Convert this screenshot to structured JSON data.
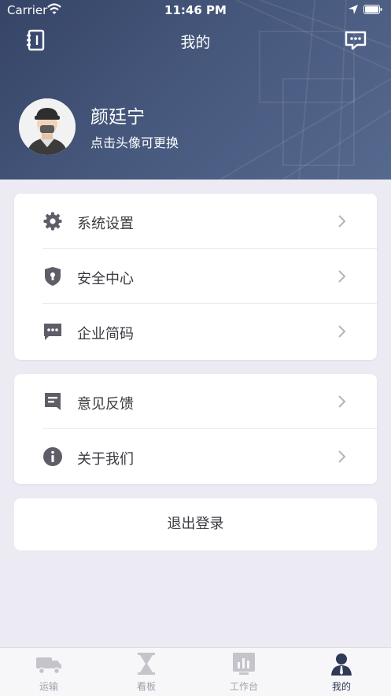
{
  "status_bar": {
    "carrier": "Carrier",
    "time": "11:46 PM"
  },
  "nav": {
    "title": "我的",
    "left_icon": "notebook-icon",
    "right_icon": "message-icon"
  },
  "profile": {
    "name": "颜廷宁",
    "hint": "点击头像可更换"
  },
  "menu_group_1": [
    {
      "label": "系统设置",
      "icon": "gear-icon"
    },
    {
      "label": "安全中心",
      "icon": "shield-icon"
    },
    {
      "label": "企业简码",
      "icon": "chat-dots-icon"
    }
  ],
  "menu_group_2": [
    {
      "label": "意见反馈",
      "icon": "feedback-icon"
    },
    {
      "label": "关于我们",
      "icon": "info-icon"
    }
  ],
  "logout": {
    "label": "退出登录"
  },
  "tabbar": [
    {
      "label": "运输",
      "icon": "truck-icon",
      "active": false
    },
    {
      "label": "看板",
      "icon": "hourglass-icon",
      "active": false
    },
    {
      "label": "工作台",
      "icon": "chart-icon",
      "active": false
    },
    {
      "label": "我的",
      "icon": "user-icon",
      "active": true
    }
  ],
  "colors": {
    "header": "#46577c",
    "background": "#ecebf3",
    "icon": "#5e5d68",
    "tab_active": "#2f3a57",
    "tab_inactive": "#a0a0a8"
  }
}
